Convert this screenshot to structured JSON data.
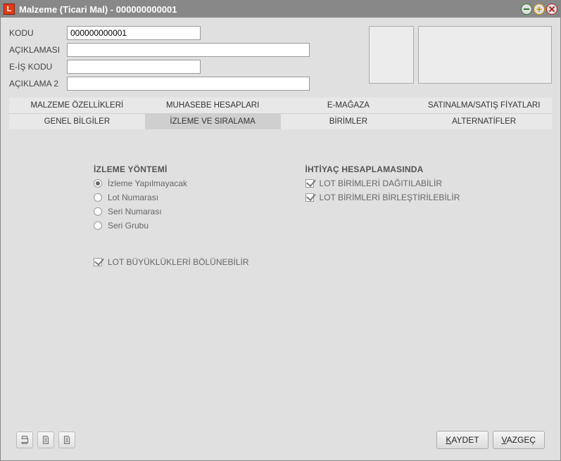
{
  "window": {
    "title": "Malzeme (Ticari Mal) - 000000000001"
  },
  "form": {
    "kodu": {
      "label": "KODU",
      "value": "000000000001"
    },
    "aciklamasi": {
      "label": "AÇIKLAMASI",
      "value": ""
    },
    "eis_kodu": {
      "label": "E-İŞ KODU",
      "value": ""
    },
    "aciklama2": {
      "label": "AÇIKLAMA 2",
      "value": ""
    }
  },
  "tabs": {
    "row1": [
      {
        "label": "MALZEME ÖZELLİKLERİ"
      },
      {
        "label": "MUHASEBE HESAPLARI"
      },
      {
        "label": "E-MAĞAZA"
      },
      {
        "label": "SATINALMA/SATIŞ FİYATLARI"
      }
    ],
    "row2": [
      {
        "label": "GENEL BİLGİLER"
      },
      {
        "label": "İZLEME VE SIRALAMA",
        "active": true
      },
      {
        "label": "BİRİMLER"
      },
      {
        "label": "ALTERNATİFLER"
      }
    ]
  },
  "izleme": {
    "title": "İZLEME YÖNTEMİ",
    "options": [
      {
        "label": "İzleme Yapılmayacak",
        "checked": true
      },
      {
        "label": "Lot Numarası"
      },
      {
        "label": "Seri Numarası"
      },
      {
        "label": "Seri Grubu"
      }
    ],
    "lot_split": {
      "label": "LOT BÜYÜKLÜKLERİ BÖLÜNEBİLİR",
      "checked": true
    }
  },
  "ihtiyac": {
    "title": "İHTİYAÇ HESAPLAMASINDA",
    "options": [
      {
        "label": "LOT BİRİMLERİ DAĞITILABİLİR",
        "checked": true
      },
      {
        "label": "LOT BİRİMLERİ BİRLEŞTİRİLEBİLİR",
        "checked": true
      }
    ]
  },
  "footer": {
    "save": "KAYDET",
    "cancel": "VAZGEÇ"
  }
}
